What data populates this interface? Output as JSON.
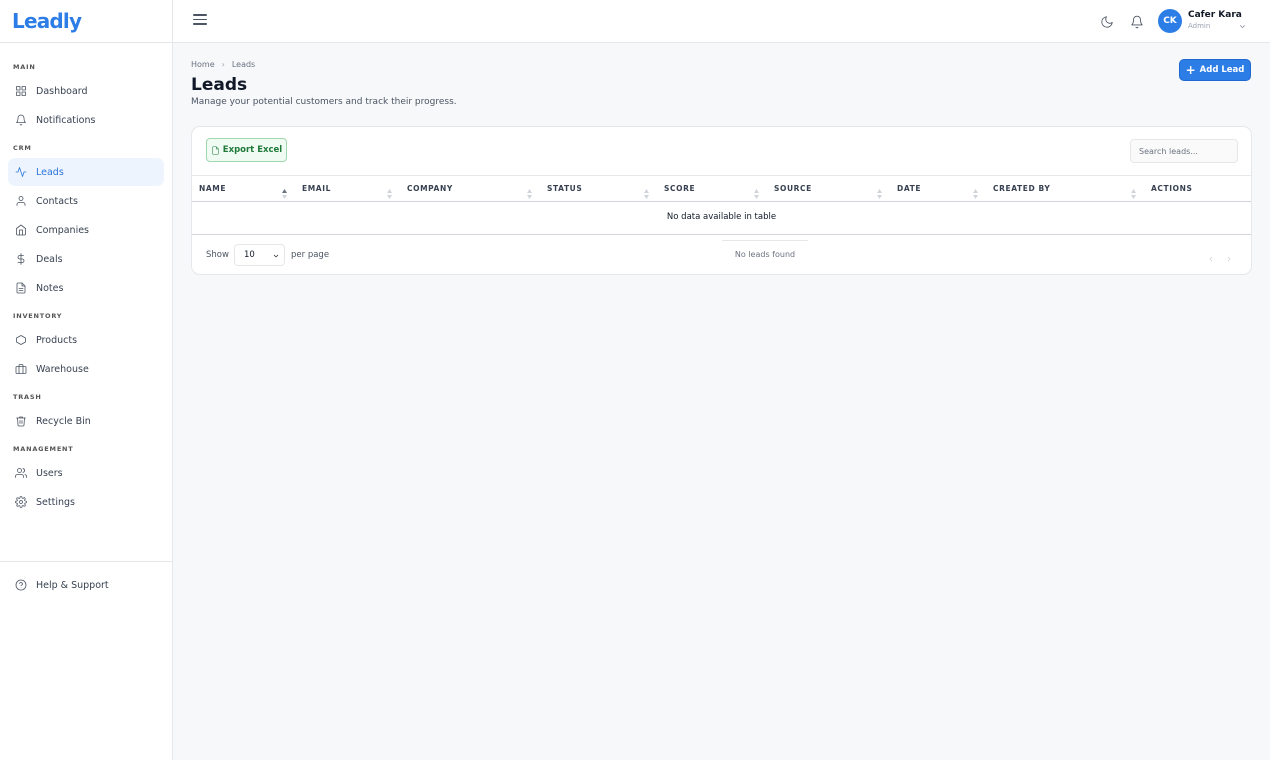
{
  "app": {
    "logo": "Leadly"
  },
  "sidebar": {
    "sections": [
      {
        "label": "MAIN",
        "items": [
          {
            "label": "Dashboard",
            "icon": "grid-icon"
          },
          {
            "label": "Notifications",
            "icon": "bell-icon"
          }
        ]
      },
      {
        "label": "CRM",
        "items": [
          {
            "label": "Leads",
            "icon": "activity-icon",
            "active": true
          },
          {
            "label": "Contacts",
            "icon": "user-icon"
          },
          {
            "label": "Companies",
            "icon": "home-icon"
          },
          {
            "label": "Deals",
            "icon": "dollar-icon"
          },
          {
            "label": "Notes",
            "icon": "file-text-icon"
          }
        ]
      },
      {
        "label": "INVENTORY",
        "items": [
          {
            "label": "Products",
            "icon": "hexagon-icon"
          },
          {
            "label": "Warehouse",
            "icon": "briefcase-icon"
          }
        ]
      },
      {
        "label": "TRASH",
        "items": [
          {
            "label": "Recycle Bin",
            "icon": "trash-icon"
          }
        ]
      },
      {
        "label": "MANAGEMENT",
        "items": [
          {
            "label": "Users",
            "icon": "users-icon"
          },
          {
            "label": "Settings",
            "icon": "gear-icon"
          }
        ]
      }
    ],
    "help": {
      "label": "Help & Support",
      "icon": "help-circle-icon"
    }
  },
  "header": {
    "user": {
      "initials": "CK",
      "name": "Cafer Kara",
      "role": "Admin"
    }
  },
  "main": {
    "breadcrumb": {
      "home": "Home",
      "current": "Leads"
    },
    "title": "Leads",
    "subtitle": "Manage your potential customers and track their progress.",
    "add_button": "Add Lead",
    "export_button": "Export Excel",
    "search_placeholder": "Search leads...",
    "columns": [
      "NAME",
      "EMAIL",
      "COMPANY",
      "STATUS",
      "SCORE",
      "SOURCE",
      "DATE",
      "CREATED BY",
      "ACTIONS"
    ],
    "empty_message": "No data available in table",
    "show_label": "Show",
    "per_page_value": "10",
    "per_page_label": "per page",
    "info_text": "No leads found"
  },
  "colors": {
    "accent": "#2d7de6",
    "export_green": "#1f7a3a"
  }
}
